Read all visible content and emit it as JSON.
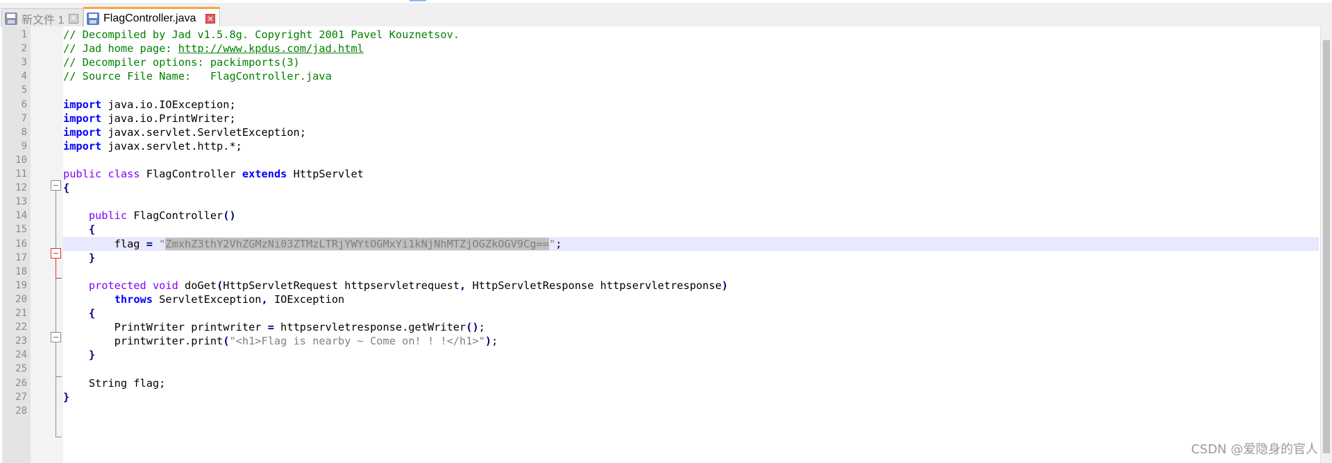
{
  "tabs": [
    {
      "label": "新文件 1",
      "active": false
    },
    {
      "label": "FlagController.java",
      "active": true
    }
  ],
  "editor": {
    "current_line": 16,
    "lines": [
      {
        "n": "1",
        "html": "<span class=\"cm\">// Decompiled by Jad v1.5.8g. Copyright 2001 Pavel Kouznetsov.</span>"
      },
      {
        "n": "2",
        "html": "<span class=\"cm\">// Jad home page: </span><span class=\"url\">http://www.kpdus.com/jad.html</span>"
      },
      {
        "n": "3",
        "html": "<span class=\"cm\">// Decompiler options: packimports(3)</span>"
      },
      {
        "n": "4",
        "html": "<span class=\"cm\">// Source File Name:   FlagController.java</span>"
      },
      {
        "n": "5",
        "html": ""
      },
      {
        "n": "6",
        "html": "<span class=\"kw\">import</span> java.io.IOException;"
      },
      {
        "n": "7",
        "html": "<span class=\"kw\">import</span> java.io.PrintWriter;"
      },
      {
        "n": "8",
        "html": "<span class=\"kw\">import</span> javax.servlet.ServletException;"
      },
      {
        "n": "9",
        "html": "<span class=\"kw\">import</span> javax.servlet.http.*;"
      },
      {
        "n": "10",
        "html": ""
      },
      {
        "n": "11",
        "html": "<span class=\"kw2\">public</span> <span class=\"kw2\">class</span> FlagController <span class=\"kw\">extends</span> HttpServlet"
      },
      {
        "n": "12",
        "html": "<span class=\"op\">{</span>"
      },
      {
        "n": "13",
        "html": ""
      },
      {
        "n": "14",
        "html": "    <span class=\"kw2\">public</span> FlagController<span class=\"op\">()</span>"
      },
      {
        "n": "15",
        "html": "    <span class=\"op\">{</span>"
      },
      {
        "n": "16",
        "html": "        flag <span class=\"op\">=</span> <span class=\"str\">\"<span class=\"sel\">ZmxhZ3thY2VhZGMzNi03ZTMzLTRjYWYtOGMxYi1kNjNhMTZjOGZkOGV9Cg==</span>\"</span>;"
      },
      {
        "n": "17",
        "html": "    <span class=\"op\">}</span>"
      },
      {
        "n": "18",
        "html": ""
      },
      {
        "n": "19",
        "html": "    <span class=\"kw2\">protected</span> <span class=\"kw2\">void</span> doGet<span class=\"op\">(</span>HttpServletRequest httpservletrequest<span class=\"op\">,</span> HttpServletResponse httpservletresponse<span class=\"op\">)</span>"
      },
      {
        "n": "20",
        "html": "        <span class=\"kw\">throws</span> ServletException<span class=\"op\">,</span> IOException"
      },
      {
        "n": "21",
        "html": "    <span class=\"op\">{</span>"
      },
      {
        "n": "22",
        "html": "        PrintWriter printwriter <span class=\"op\">=</span> httpservletresponse.getWriter<span class=\"op\">()</span>;"
      },
      {
        "n": "23",
        "html": "        printwriter.print<span class=\"op\">(</span><span class=\"str\">\"&lt;h1&gt;Flag is nearby ~ Come on! ! !&lt;/h1&gt;\"</span><span class=\"op\">)</span>;"
      },
      {
        "n": "24",
        "html": "    <span class=\"op\">}</span>"
      },
      {
        "n": "25",
        "html": ""
      },
      {
        "n": "26",
        "html": "    String flag;"
      },
      {
        "n": "27",
        "html": "<span class=\"op\">}</span>"
      },
      {
        "n": "28",
        "html": ""
      }
    ]
  },
  "watermark": "CSDN @爱隐身的官人",
  "colors": {
    "comment": "#008000",
    "keyword": "#0000ff",
    "modifier": "#8000ff",
    "string": "#808080",
    "current_line": "#e8e8ff",
    "tab_accent": "#f7a541"
  }
}
